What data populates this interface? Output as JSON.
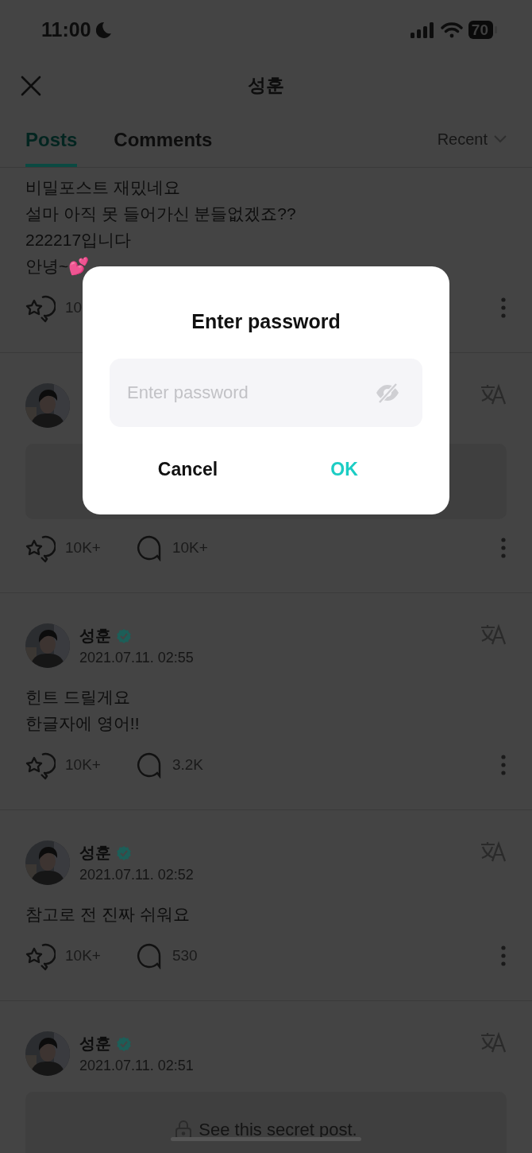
{
  "status_bar": {
    "time": "11:00",
    "battery": "70"
  },
  "header": {
    "title": "성훈"
  },
  "tabs": [
    {
      "label": "Posts",
      "selected": true
    },
    {
      "label": "Comments",
      "selected": false
    }
  ],
  "sort": {
    "label": "Recent"
  },
  "posts": [
    {
      "kind": "text",
      "lines": [
        "비밀포스트 재밌네요",
        "설마 아직 못 들어가신 분들없겠죠??",
        "222217입니다",
        "안녕~💕"
      ],
      "likes": "10",
      "more": true
    },
    {
      "kind": "secret",
      "avatar": true,
      "translate": true,
      "likes": "10K+",
      "comments": "10K+",
      "more": true
    },
    {
      "kind": "text",
      "avatar": true,
      "author": "성훈",
      "verified": true,
      "date": "2021.07.11. 02:55",
      "translate": true,
      "lines": [
        "힌트 드릴게요",
        "한글자에 영어!!"
      ],
      "likes": "10K+",
      "comments": "3.2K",
      "more": true
    },
    {
      "kind": "text",
      "avatar": true,
      "author": "성훈",
      "verified": true,
      "date": "2021.07.11. 02:52",
      "translate": true,
      "lines": [
        "참고로 전 진짜 쉬워요"
      ],
      "likes": "10K+",
      "comments": "530",
      "more": true
    },
    {
      "kind": "secret",
      "avatar": true,
      "author": "성훈",
      "verified": true,
      "date": "2021.07.11. 02:51",
      "translate": true,
      "secret_label": "See this secret post."
    }
  ],
  "dialog": {
    "title": "Enter password",
    "field": {
      "placeholder": "Enter password"
    },
    "buttons": [
      {
        "label": "Cancel",
        "kind": "cancel"
      },
      {
        "label": "OK",
        "kind": "confirm"
      }
    ]
  }
}
